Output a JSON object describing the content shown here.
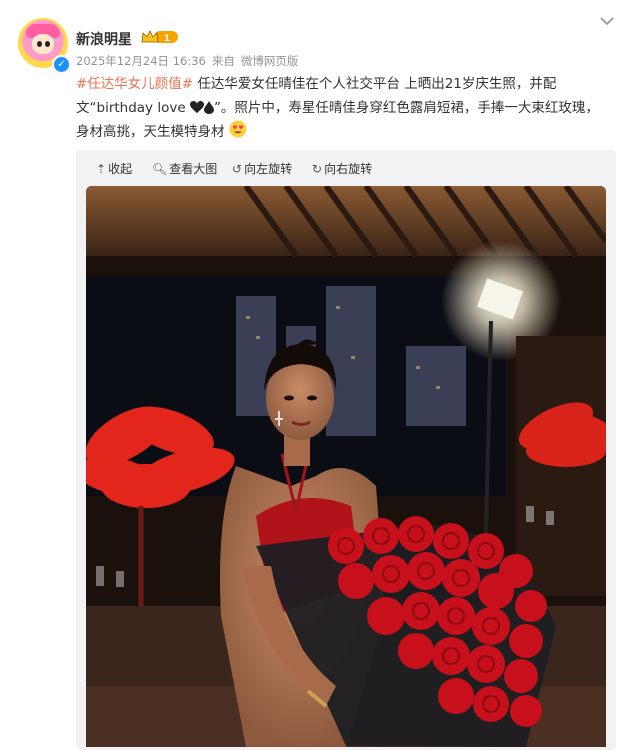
{
  "account": {
    "name": "新浪明星",
    "badge_icon": "vip-crown-badge-icon",
    "verified_icon": "verified-v-icon"
  },
  "meta": {
    "date": "2025年12月24日 16:36",
    "source_prefix": "来自",
    "source": "微博网页版"
  },
  "post": {
    "hashtag": "#任达华女儿颜值#",
    "text_part1": " 任达华爱女任晴佳在个人社交平台 上晒出21岁庆生照，并配文“birthday love ",
    "text_part2": "”。照片中，寿星任晴佳身穿红色露肩短裙，手捧一大束红玫瑰，身材高挑，天生模特身材",
    "emoji_icons": [
      "black-heart-icon",
      "black-drop-icon",
      "heart-eyes-emoji-icon"
    ]
  },
  "toolbar": {
    "collapse_label": "收起",
    "view_large_label": "查看大图",
    "rotate_left_label": "向左旋转",
    "rotate_right_label": "向右旋转"
  },
  "colors": {
    "hashtag": "#eb7350",
    "meta_gray": "#939393",
    "verified_blue": "#1e90ff",
    "media_bg": "#f2f2f5"
  }
}
